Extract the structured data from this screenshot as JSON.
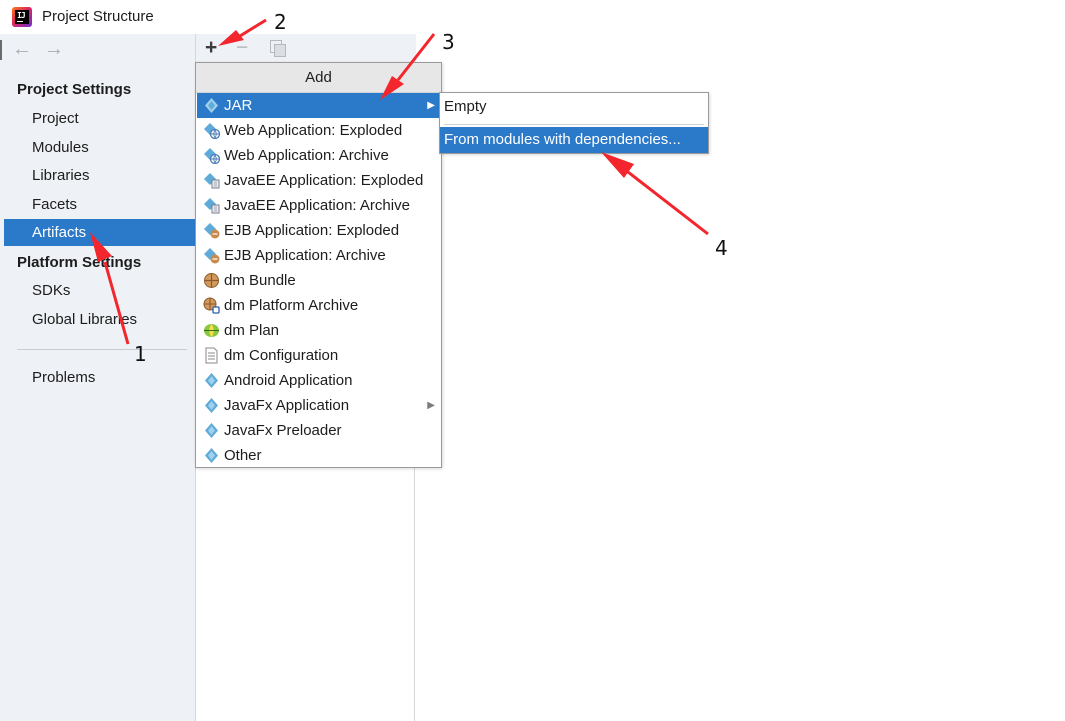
{
  "window": {
    "title": "Project Structure",
    "app_icon_text": "IJ"
  },
  "nav": {
    "back_icon": "arrow-left-icon",
    "forward_icon": "arrow-right-icon"
  },
  "sidebar": {
    "project_settings_header": "Project Settings",
    "project_settings_items": [
      {
        "label": "Project"
      },
      {
        "label": "Modules"
      },
      {
        "label": "Libraries"
      },
      {
        "label": "Facets"
      },
      {
        "label": "Artifacts",
        "selected": true
      }
    ],
    "platform_settings_header": "Platform Settings",
    "platform_settings_items": [
      {
        "label": "SDKs"
      },
      {
        "label": "Global Libraries"
      }
    ],
    "problems_label": "Problems"
  },
  "toolbar": {
    "add_symbol": "+",
    "remove_symbol": "−"
  },
  "add_popup": {
    "header": "Add",
    "items": [
      {
        "label": "JAR",
        "icon": "jar-icon",
        "has_submenu": true,
        "selected": true
      },
      {
        "label": "Web Application: Exploded",
        "icon": "web-app-icon"
      },
      {
        "label": "Web Application: Archive",
        "icon": "web-app-icon"
      },
      {
        "label": "JavaEE Application: Exploded",
        "icon": "javaee-app-icon"
      },
      {
        "label": "JavaEE Application: Archive",
        "icon": "javaee-app-icon"
      },
      {
        "label": "EJB Application: Exploded",
        "icon": "ejb-app-icon"
      },
      {
        "label": "EJB Application: Archive",
        "icon": "ejb-app-icon"
      },
      {
        "label": "dm Bundle",
        "icon": "dm-bundle-icon"
      },
      {
        "label": "dm Platform Archive",
        "icon": "dm-platform-archive-icon"
      },
      {
        "label": "dm Plan",
        "icon": "dm-plan-icon"
      },
      {
        "label": "dm Configuration",
        "icon": "dm-configuration-icon"
      },
      {
        "label": "Android Application",
        "icon": "android-app-icon"
      },
      {
        "label": "JavaFx Application",
        "icon": "javafx-app-icon",
        "has_submenu": true
      },
      {
        "label": "JavaFx Preloader",
        "icon": "javafx-preloader-icon"
      },
      {
        "label": "Other",
        "icon": "other-artifact-icon"
      }
    ]
  },
  "jar_submenu": {
    "items": [
      {
        "label": "Empty"
      },
      {
        "label": "From modules with dependencies...",
        "selected": true
      }
    ]
  },
  "annotations": {
    "labels": [
      "1",
      "2",
      "3",
      "4"
    ],
    "color": "#f2262c"
  },
  "colors": {
    "selection": "#2b79c9",
    "sidebar_bg": "#eef1f5"
  }
}
